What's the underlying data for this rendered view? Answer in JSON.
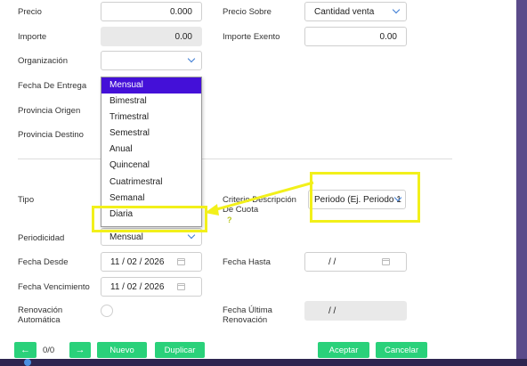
{
  "form": {
    "precio": {
      "label": "Precio",
      "value": "0.000"
    },
    "precio_sobre": {
      "label": "Precio Sobre",
      "value": "Cantidad venta"
    },
    "importe": {
      "label": "Importe",
      "value": "0.00"
    },
    "importe_exento": {
      "label": "Importe Exento",
      "value": "0.00"
    },
    "organizacion": {
      "label": "Organización",
      "value": ""
    },
    "fecha_entrega": {
      "label": "Fecha De Entrega"
    },
    "provincia_origen": {
      "label": "Provincia Origen"
    },
    "provincia_destino": {
      "label": "Provincia Destino"
    },
    "tipo": {
      "label": "Tipo"
    },
    "criterio": {
      "label": "Criterio Descripción De Cuota",
      "value": "Periodo (Ej. Periodo 1"
    },
    "periodicidad": {
      "label": "Periodicidad",
      "value": "Mensual"
    },
    "fecha_desde": {
      "label": "Fecha Desde",
      "value": "11 / 02 / 2026"
    },
    "fecha_hasta": {
      "label": "Fecha Hasta",
      "value": "/      /"
    },
    "fecha_vencimiento": {
      "label": "Fecha Vencimiento",
      "value": "11 / 02 / 2026"
    },
    "renovacion": {
      "label": "Renovación Automática"
    },
    "fecha_ultima_renovacion": {
      "label": "Fecha Última Renovación",
      "value": "/      /"
    },
    "help_mark": "?"
  },
  "dropdown": {
    "options": [
      "Mensual",
      "Bimestral",
      "Trimestral",
      "Semestral",
      "Anual",
      "Quincenal",
      "Cuatrimestral",
      "Semanal",
      "Diaria"
    ],
    "selected": "Mensual"
  },
  "footer": {
    "prev_icon": "arrow-left-icon",
    "next_icon": "arrow-right-icon",
    "pager": "0/0",
    "nuevo": "Nuevo",
    "duplicar": "Duplicar",
    "aceptar": "Aceptar",
    "cancelar": "Cancelar"
  },
  "colors": {
    "accent_green": "#2ad17a",
    "highlight_yellow": "#f2f01a",
    "selected_option": "#4410d8",
    "chevron_blue": "#3b7bd4"
  }
}
